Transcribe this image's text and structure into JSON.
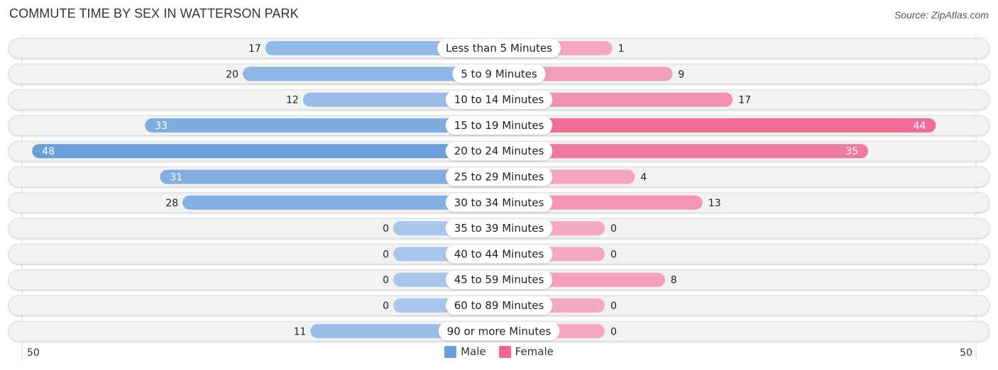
{
  "header": {
    "title": "COMMUTE TIME BY SEX IN WATTERSON PARK",
    "source": "Source: ZipAtlas.com"
  },
  "colors": {
    "male": "#6a9fdc",
    "male_light": "#a9c7ec",
    "female": "#f06792",
    "female_light": "#f5a9c1",
    "track": "#f2f2f2"
  },
  "chart_data": {
    "type": "bar",
    "orientation": "horizontal-diverging",
    "title": "COMMUTE TIME BY SEX IN WATTERSON PARK",
    "categories": [
      "Less than 5 Minutes",
      "5 to 9 Minutes",
      "10 to 14 Minutes",
      "15 to 19 Minutes",
      "20 to 24 Minutes",
      "25 to 29 Minutes",
      "30 to 34 Minutes",
      "35 to 39 Minutes",
      "40 to 44 Minutes",
      "45 to 59 Minutes",
      "60 to 89 Minutes",
      "90 or more Minutes"
    ],
    "series": [
      {
        "name": "Male",
        "values": [
          17,
          20,
          12,
          33,
          48,
          31,
          28,
          0,
          0,
          0,
          0,
          11
        ]
      },
      {
        "name": "Female",
        "values": [
          1,
          9,
          17,
          44,
          35,
          4,
          13,
          0,
          0,
          8,
          0,
          0
        ]
      }
    ],
    "axis": {
      "left_label": "50",
      "right_label": "50",
      "range": [
        -50,
        50
      ]
    },
    "legend": {
      "position": "bottom-center",
      "entries": [
        "Male",
        "Female"
      ]
    }
  }
}
